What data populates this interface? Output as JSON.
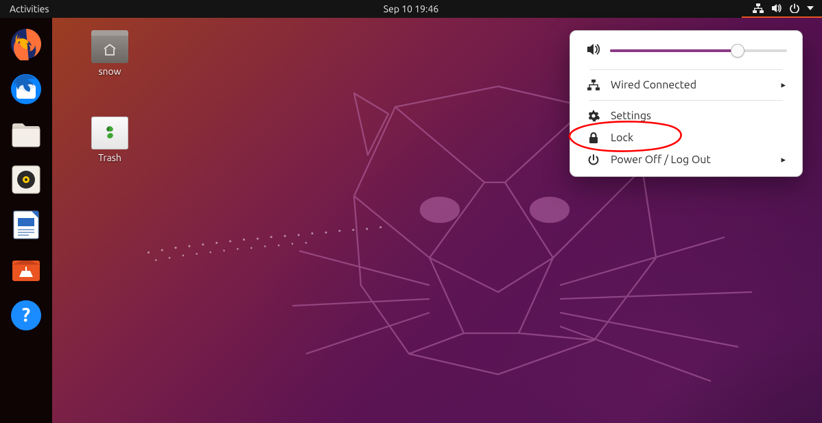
{
  "top_bar": {
    "activities_label": "Activities",
    "clock_text": "Sep 10  19:46",
    "status_icons": [
      "network-wired-icon",
      "volume-icon",
      "power-icon",
      "dropdown-icon"
    ]
  },
  "dock_items": [
    {
      "name": "firefox",
      "icon": "firefox-icon"
    },
    {
      "name": "thunderbird",
      "icon": "thunderbird-icon"
    },
    {
      "name": "files",
      "icon": "files-icon"
    },
    {
      "name": "rhythmbox",
      "icon": "rhythmbox-icon"
    },
    {
      "name": "libreoffice-writer",
      "icon": "writer-icon"
    },
    {
      "name": "ubuntu-software",
      "icon": "software-icon"
    },
    {
      "name": "help",
      "icon": "help-icon"
    }
  ],
  "desktop_icons": [
    {
      "name": "snow",
      "label": "snow",
      "kind": "folder"
    },
    {
      "name": "trash",
      "label": "Trash",
      "kind": "trash"
    }
  ],
  "system_menu": {
    "volume_percent": 72,
    "items": [
      {
        "id": "wired",
        "label": "Wired Connected",
        "icon": "network-wired-icon",
        "submenu": true
      },
      {
        "id": "settings",
        "label": "Settings",
        "icon": "gear-icon",
        "submenu": false
      },
      {
        "id": "lock",
        "label": "Lock",
        "icon": "lock-icon",
        "submenu": false
      },
      {
        "id": "power",
        "label": "Power Off / Log Out",
        "icon": "power-icon",
        "submenu": true
      }
    ]
  },
  "annotation": {
    "target_item_id": "settings",
    "color": "#ff0000"
  }
}
